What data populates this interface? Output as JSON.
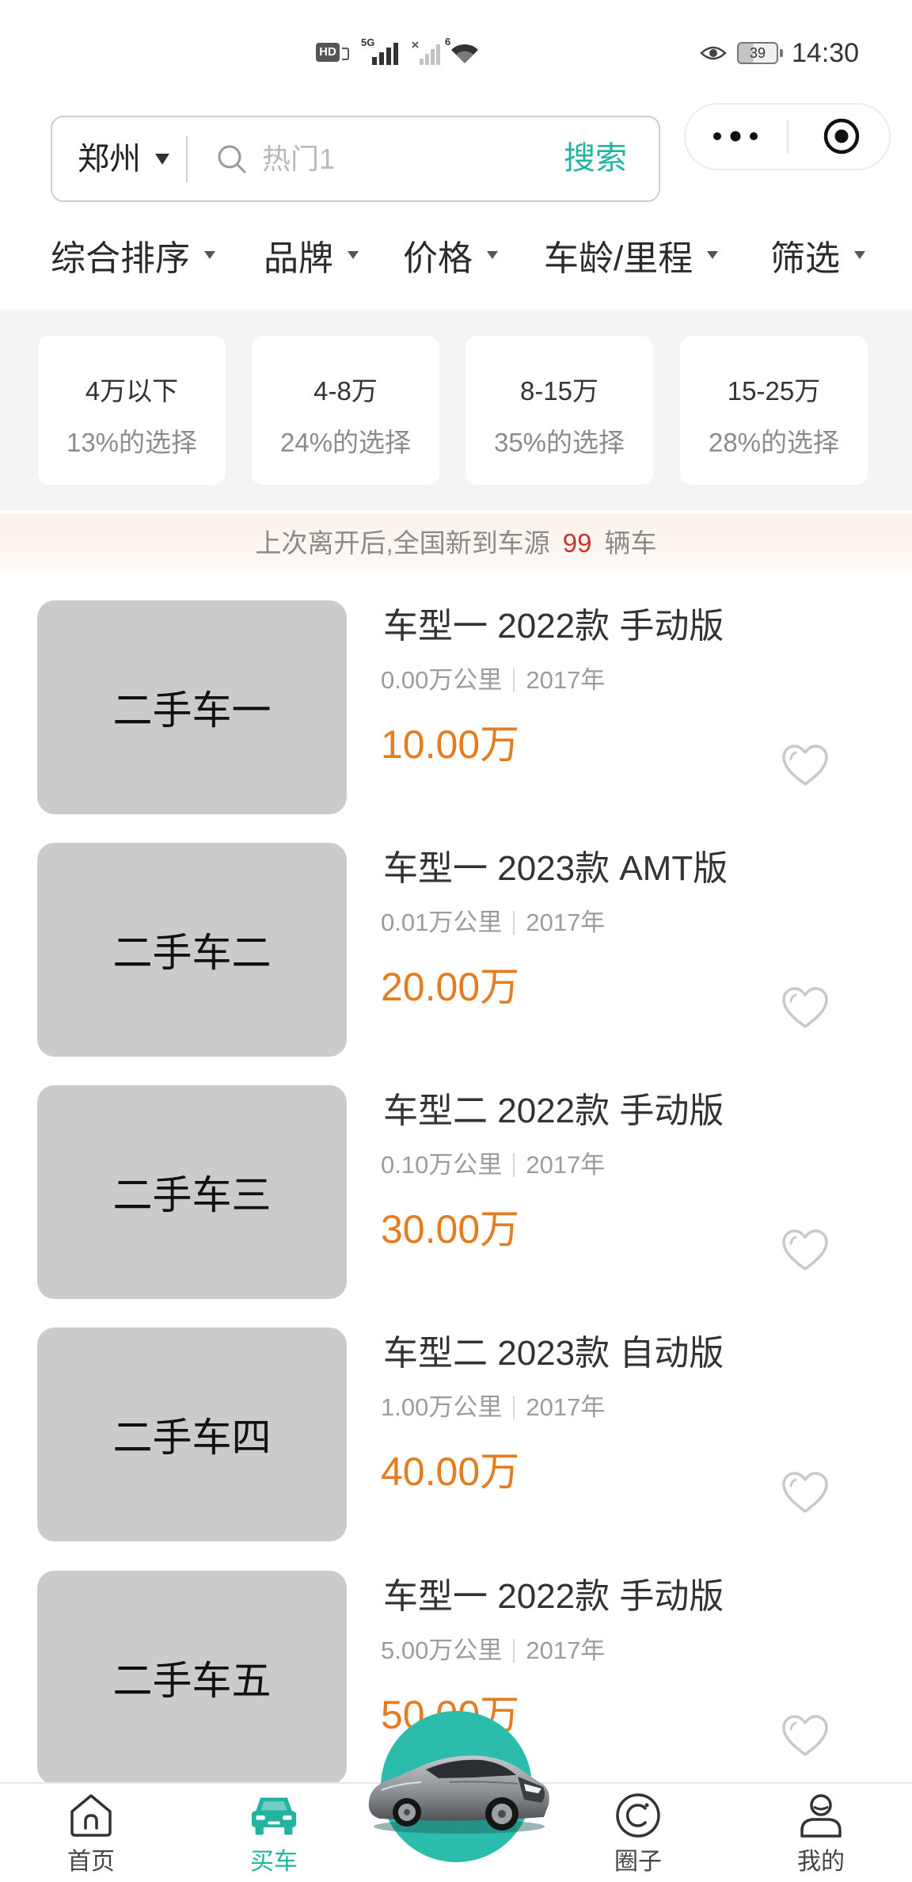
{
  "status_bar": {
    "hd": "HD",
    "network": "5G",
    "wifi_badge": "6",
    "battery": "39",
    "time": "14:30"
  },
  "search": {
    "city": "郑州",
    "placeholder": "热门1",
    "button_label": "搜索"
  },
  "capsule": {
    "more_icon": "more-dots-icon",
    "close_icon": "target-icon"
  },
  "filters": [
    {
      "label": "综合排序"
    },
    {
      "label": "品牌"
    },
    {
      "label": "价格"
    },
    {
      "label": "车龄/里程"
    },
    {
      "label": "筛选"
    }
  ],
  "price_ranges": [
    {
      "range": "4万以下",
      "share": "13%的选择"
    },
    {
      "range": "4-8万",
      "share": "24%的选择"
    },
    {
      "range": "8-15万",
      "share": "35%的选择"
    },
    {
      "range": "15-25万",
      "share": "28%的选择"
    }
  ],
  "notice": {
    "prefix": "上次离开后,全国新到车源",
    "count": "99",
    "suffix": "辆车"
  },
  "cars": [
    {
      "image_label": "二手车一",
      "title": "车型一 2022款 手动版",
      "mileage": "0.00万公里",
      "year": "2017年",
      "price": "10.00万",
      "favorited": false
    },
    {
      "image_label": "二手车二",
      "title": "车型一 2023款 AMT版",
      "mileage": "0.01万公里",
      "year": "2017年",
      "price": "20.00万",
      "favorited": false
    },
    {
      "image_label": "二手车三",
      "title": "车型二 2022款 手动版",
      "mileage": "0.10万公里",
      "year": "2017年",
      "price": "30.00万",
      "favorited": false
    },
    {
      "image_label": "二手车四",
      "title": "车型二 2023款 自动版",
      "mileage": "1.00万公里",
      "year": "2017年",
      "price": "40.00万",
      "favorited": false
    },
    {
      "image_label": "二手车五",
      "title": "车型一 2022款 手动版",
      "mileage": "5.00万公里",
      "year": "2017年",
      "price": "50.00万",
      "favorited": false
    }
  ],
  "tabbar": {
    "items": [
      {
        "label": "首页",
        "icon": "home-icon",
        "active": false
      },
      {
        "label": "买车",
        "icon": "car-icon",
        "active": true
      },
      {
        "icon": "car-promo-image"
      },
      {
        "label": "圈子",
        "icon": "circle-icon",
        "active": false
      },
      {
        "label": "我的",
        "icon": "user-icon",
        "active": false
      }
    ]
  },
  "colors": {
    "accent": "#22b3a1",
    "price": "#e47d1f",
    "highlight": "#c8342f",
    "center_button": "#2cbcab"
  }
}
